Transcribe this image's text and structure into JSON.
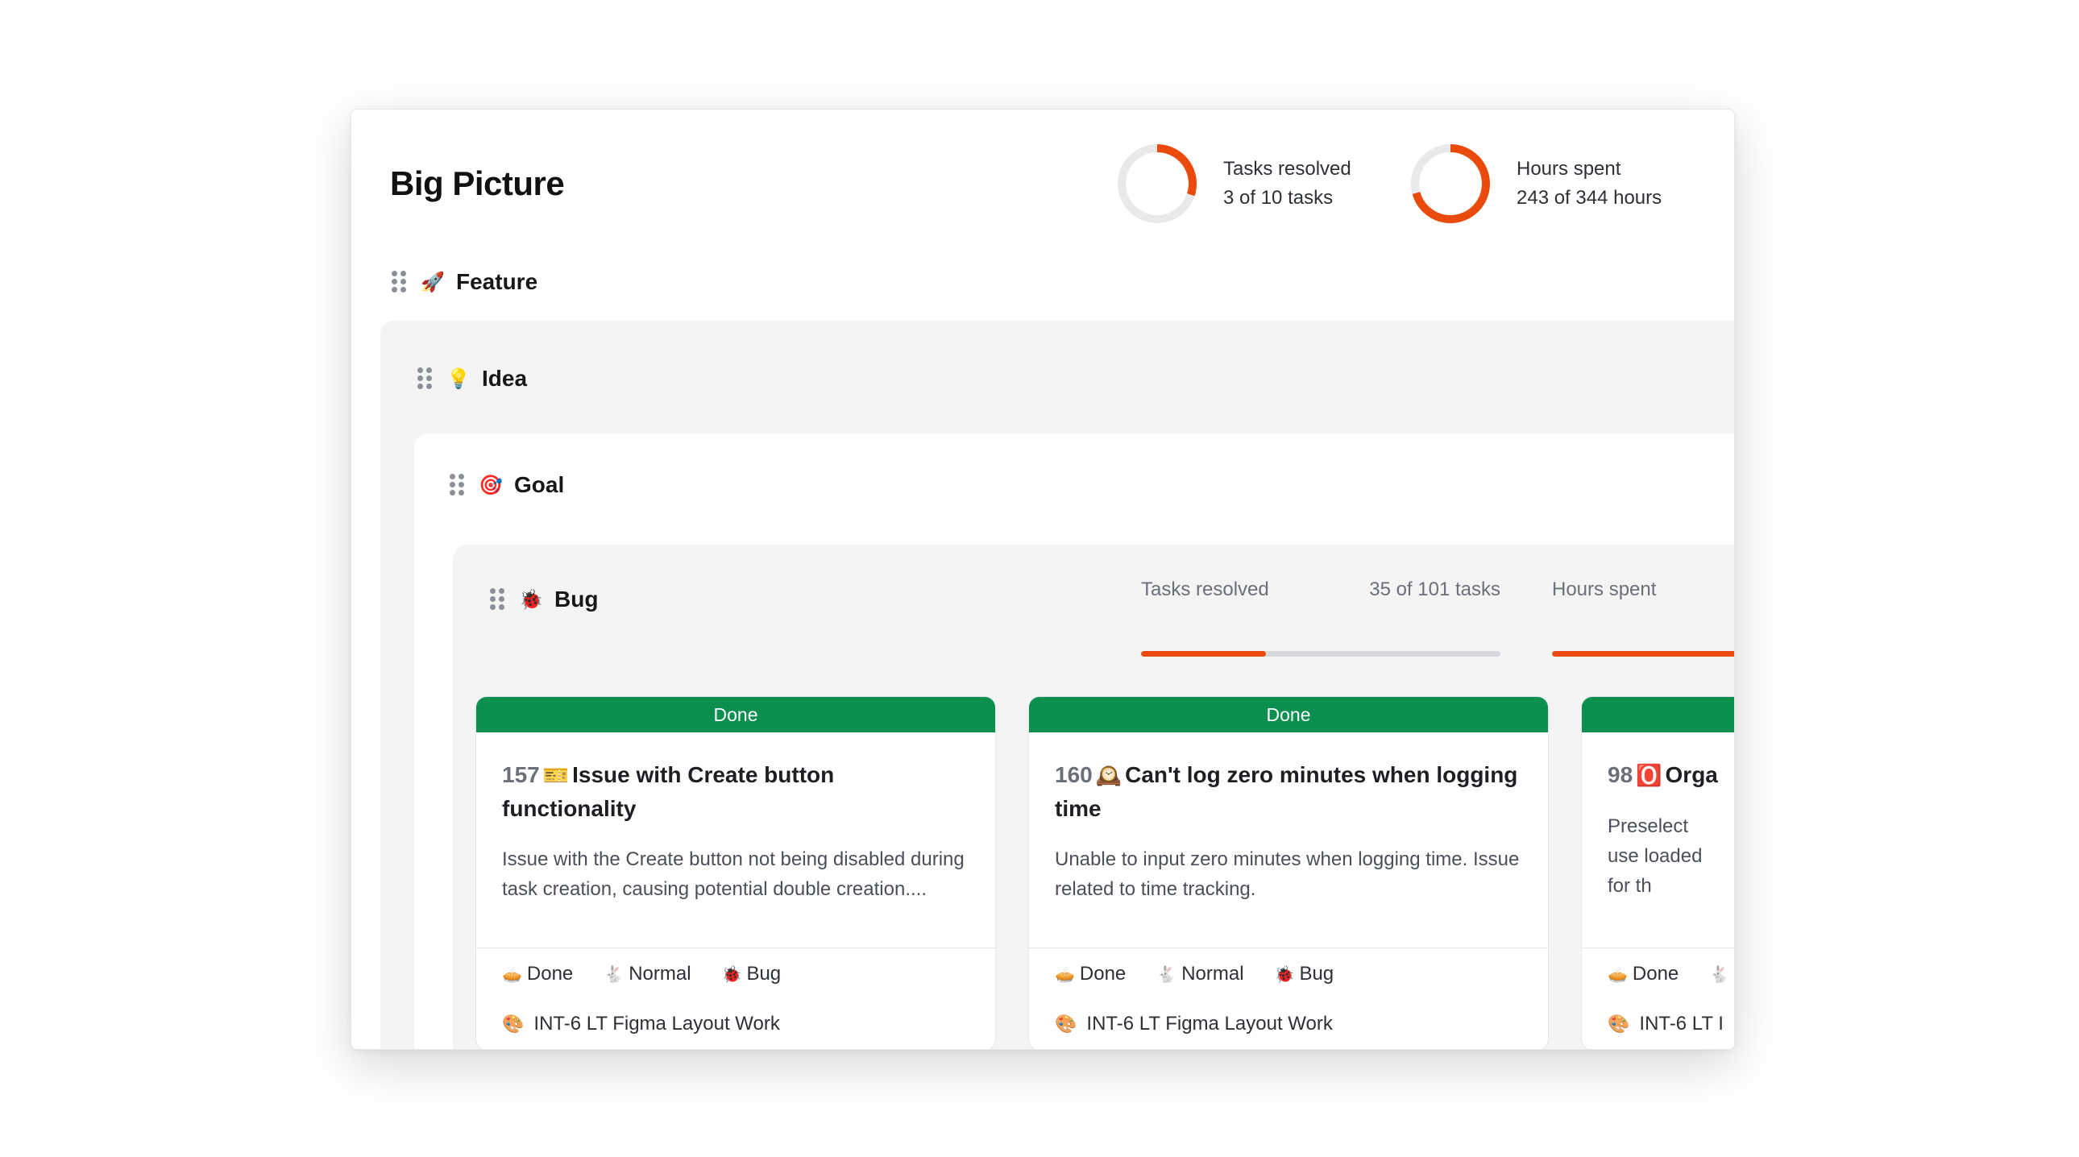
{
  "page": {
    "title": "Big Picture"
  },
  "stats": [
    {
      "label": "Tasks resolved",
      "value": "3 of 10 tasks",
      "fraction": 0.3
    },
    {
      "label": "Hours spent",
      "value": "243 of 344 hours",
      "fraction": 0.7064
    }
  ],
  "rows": {
    "feature": {
      "emoji": "🚀",
      "name": "Feature"
    },
    "idea": {
      "emoji": "💡",
      "name": "Idea"
    },
    "goal": {
      "emoji": "🎯",
      "name": "Goal"
    },
    "bug": {
      "emoji": "🐞",
      "name": "Bug"
    }
  },
  "bug_progress": {
    "tasks_label": "Tasks resolved",
    "tasks_value": "35 of 101 tasks",
    "tasks_fraction": 0.3465,
    "hours_label": "Hours spent",
    "hours_fraction": 1.0
  },
  "cards": [
    {
      "status": "Done",
      "number": "157",
      "emoji": "🎫",
      "title": "Issue with Create button functionality",
      "description": "Issue with the Create button not being disabled during task creation, causing potential double creation....",
      "meta": [
        {
          "icon": "🥧",
          "label": "Done"
        },
        {
          "icon": "🐇",
          "label": "Normal"
        },
        {
          "icon": "🐞",
          "label": "Bug"
        }
      ],
      "project_icon": "🎨",
      "project": "INT-6 LT Figma Layout Work"
    },
    {
      "status": "Done",
      "number": "160",
      "emoji": "🕰️",
      "title": "Can't log zero minutes when logging time",
      "description": "Unable to input zero minutes when logging time. Issue related to time tracking.",
      "meta": [
        {
          "icon": "🥧",
          "label": "Done"
        },
        {
          "icon": "🐇",
          "label": "Normal"
        },
        {
          "icon": "🐞",
          "label": "Bug"
        }
      ],
      "project_icon": "🎨",
      "project": "INT-6 LT Figma Layout Work"
    },
    {
      "status": "",
      "number": "98",
      "emoji": "🅾️",
      "title": "Orga",
      "description": "Preselect use loaded for th",
      "meta": [
        {
          "icon": "🥧",
          "label": "Done"
        },
        {
          "icon": "🐇",
          "label": ""
        }
      ],
      "project_icon": "🎨",
      "project": "INT-6 LT I"
    }
  ],
  "colors": {
    "accent": "#eb4a0d",
    "done_green": "#0a8f4f",
    "track": "#e5e6e8"
  }
}
